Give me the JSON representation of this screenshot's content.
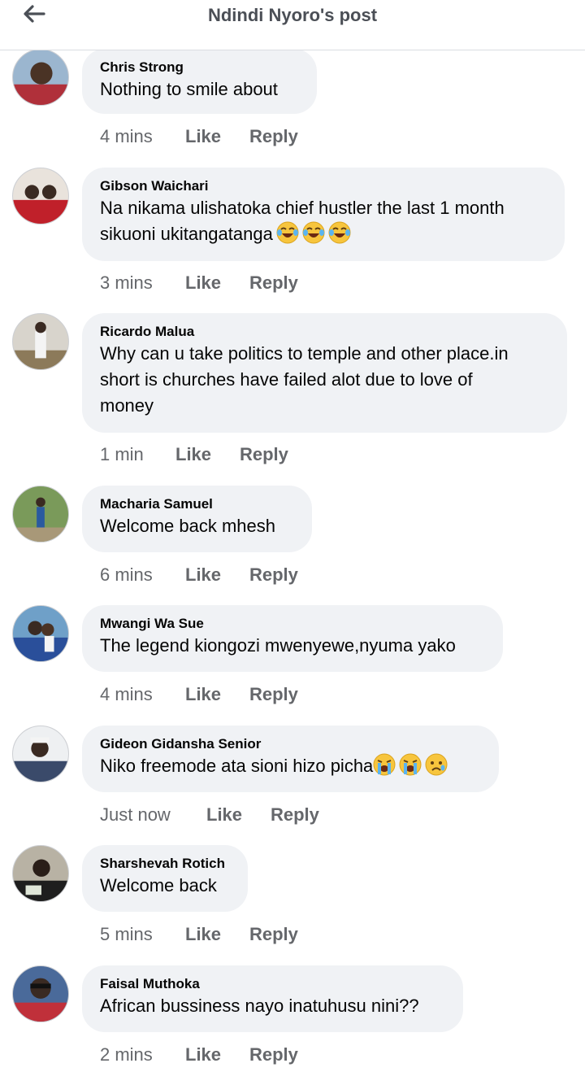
{
  "header": {
    "title": "Ndindi Nyoro's post",
    "back_icon": "arrow-left-icon"
  },
  "colors": {
    "bubble": "#f0f2f5",
    "meta": "#65676b",
    "header_title": "#4b4f56"
  },
  "comments": [
    {
      "author": "Chris Strong",
      "text": "Nothing to smile about",
      "time": "4 mins",
      "like": "Like",
      "reply": "Reply",
      "emojis": []
    },
    {
      "author": "Gibson Waichari",
      "text": "Na nikama ulishatoka chief hustler the last 1 month\nsikuoni ukitangatanga",
      "time": "3 mins",
      "like": "Like",
      "reply": "Reply",
      "emojis": [
        "laughing-tears-emoji",
        "laughing-tears-emoji",
        "laughing-tears-emoji"
      ]
    },
    {
      "author": "Ricardo Malua",
      "text": "Why can u take politics to temple and other place.in\nshort is churches have failed alot due to love of\nmoney",
      "time": "1 min",
      "like": "Like",
      "reply": "Reply",
      "emojis": []
    },
    {
      "author": "Macharia Samuel",
      "text": "Welcome back mhesh",
      "time": "6 mins",
      "like": "Like",
      "reply": "Reply",
      "emojis": []
    },
    {
      "author": "Mwangi Wa Sue",
      "text": "The legend kiongozi mwenyewe,nyuma yako",
      "time": "4 mins",
      "like": "Like",
      "reply": "Reply",
      "emojis": []
    },
    {
      "author": "Gideon Gidansha Senior",
      "text": "Niko freemode ata sioni hizo picha",
      "time": "Just now",
      "like": "Like",
      "reply": "Reply",
      "emojis": [
        "loudly-crying-emoji",
        "loudly-crying-emoji",
        "sad-tear-emoji"
      ]
    },
    {
      "author": "Sharshevah Rotich",
      "text": "Welcome back",
      "time": "5 mins",
      "like": "Like",
      "reply": "Reply",
      "emojis": []
    },
    {
      "author": "Faisal Muthoka",
      "text": "African bussiness nayo inatuhusu nini??",
      "time": "2 mins",
      "like": "Like",
      "reply": "Reply",
      "emojis": []
    }
  ]
}
